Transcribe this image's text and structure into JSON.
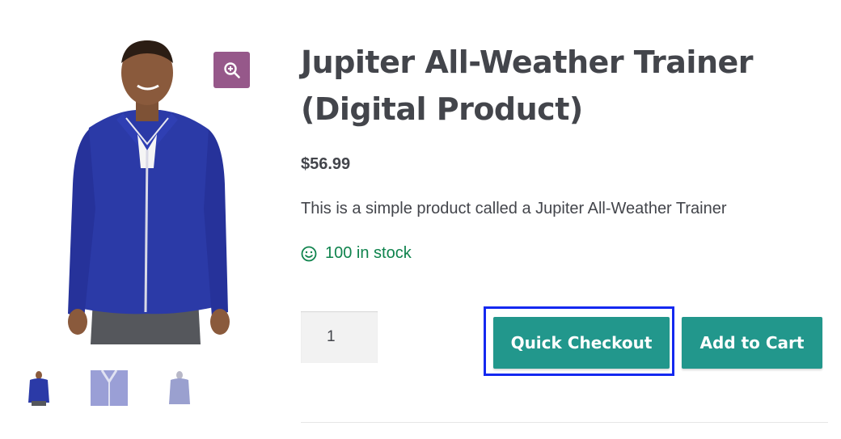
{
  "product": {
    "title_line1": "Jupiter All-Weather Trainer",
    "title_line2": "(Digital Product)",
    "price": "$56.99",
    "description": "This is a simple product called a Jupiter All-Weather Trainer",
    "stock": "100 in stock",
    "stock_icon": "smiley-icon"
  },
  "gallery": {
    "zoom_icon": "zoom-in-icon",
    "thumbnails": [
      "thumbnail-1",
      "thumbnail-2",
      "thumbnail-3"
    ]
  },
  "cart": {
    "quantity": "1",
    "quick_checkout_label": "Quick Checkout",
    "add_to_cart_label": "Add to Cart"
  },
  "colors": {
    "accent": "#22978c",
    "zoom_button": "#96588a",
    "stock_text": "#0f834d",
    "highlight_box": "#1428f0"
  }
}
